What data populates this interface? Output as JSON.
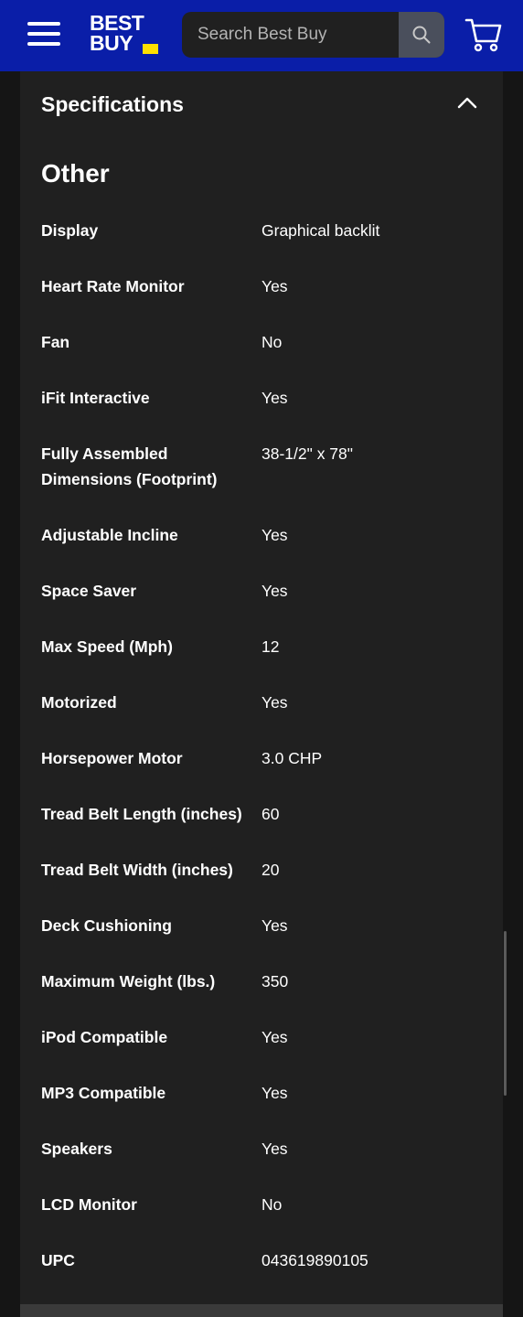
{
  "header": {
    "logo_text": "BEST\nBUY",
    "search_placeholder": "Search Best Buy",
    "colors": {
      "bar": "#0a1ea8",
      "logo_tag": "#ffe000"
    },
    "icons": [
      "menu-icon",
      "search-icon",
      "cart-icon"
    ]
  },
  "specifications": {
    "title": "Specifications",
    "expanded": true,
    "group_title": "Other",
    "rows": [
      {
        "name": "Display",
        "value": "Graphical backlit"
      },
      {
        "name": "Heart Rate Monitor",
        "value": "Yes"
      },
      {
        "name": "Fan",
        "value": "No"
      },
      {
        "name": "iFit Interactive",
        "value": "Yes"
      },
      {
        "name": "Fully Assembled Dimensions (Footprint)",
        "value": "38-1/2\" x 78\""
      },
      {
        "name": "Adjustable Incline",
        "value": "Yes"
      },
      {
        "name": "Space Saver",
        "value": "Yes"
      },
      {
        "name": "Max Speed (Mph)",
        "value": "12"
      },
      {
        "name": "Motorized",
        "value": "Yes"
      },
      {
        "name": "Horsepower Motor",
        "value": "3.0 CHP"
      },
      {
        "name": "Tread Belt Length (inches)",
        "value": "60"
      },
      {
        "name": "Tread Belt Width (inches)",
        "value": "20"
      },
      {
        "name": "Deck Cushioning",
        "value": "Yes"
      },
      {
        "name": "Maximum Weight (lbs.)",
        "value": "350"
      },
      {
        "name": "iPod Compatible",
        "value": "Yes"
      },
      {
        "name": "MP3 Compatible",
        "value": "Yes"
      },
      {
        "name": "Speakers",
        "value": "Yes"
      },
      {
        "name": "LCD Monitor",
        "value": "No"
      },
      {
        "name": "UPC",
        "value": "043619890105"
      }
    ]
  }
}
